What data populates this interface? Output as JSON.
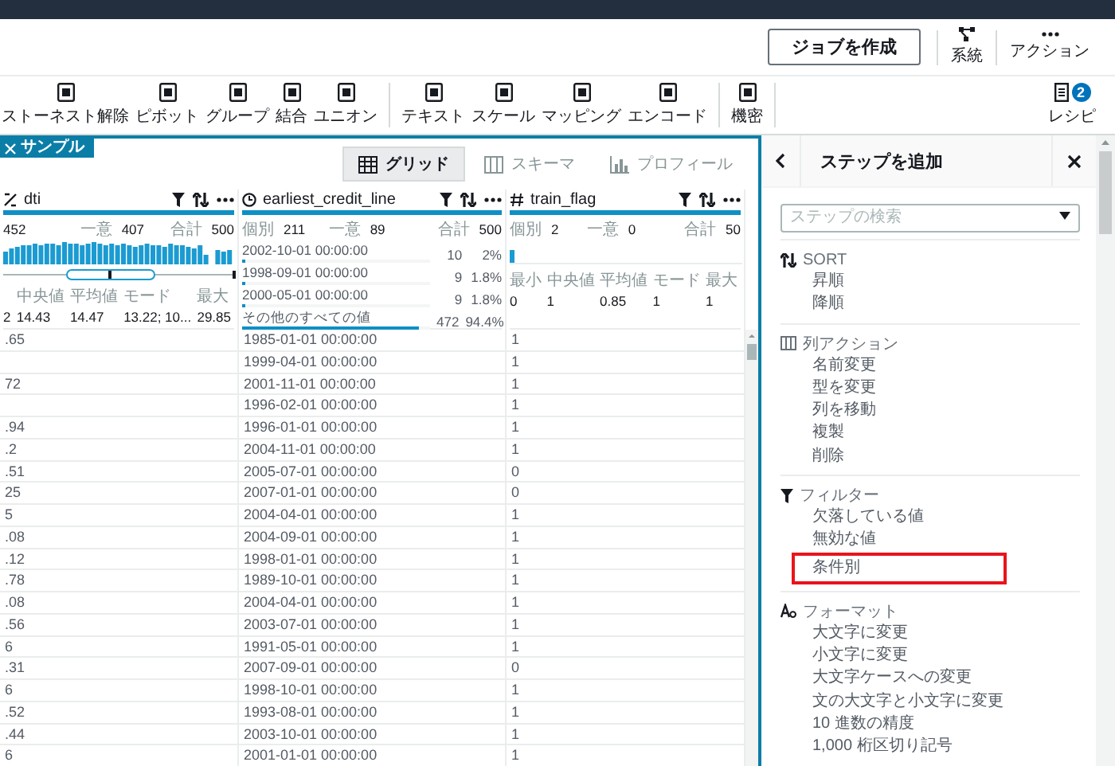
{
  "header": {
    "create_job_button": "ジョブを作成",
    "actions": [
      {
        "kind": "lineage",
        "label": "系統"
      },
      {
        "kind": "more",
        "label": "アクション"
      }
    ]
  },
  "toolbar": {
    "groups": [
      [
        {
          "label": "ストーネスト解除"
        },
        {
          "label": "ピボット"
        },
        {
          "label": "グループ"
        },
        {
          "label": "結合"
        },
        {
          "label": "ユニオン"
        }
      ],
      [
        {
          "label": "テキスト"
        },
        {
          "label": "スケール"
        },
        {
          "label": "マッピング"
        },
        {
          "label": "エンコード"
        }
      ],
      [
        {
          "label": "機密"
        }
      ]
    ],
    "recipe": {
      "label": "レシピ",
      "badge": "2"
    }
  },
  "dataset": {
    "sample_tag": "サンプル",
    "views": [
      {
        "kind": "grid",
        "label": "グリッド",
        "selected": true
      },
      {
        "kind": "schema",
        "label": "スキーマ",
        "selected": false
      },
      {
        "kind": "profile",
        "label": "プロフィール",
        "selected": false
      }
    ],
    "columns": [
      {
        "name": "dti",
        "kind": "decimal",
        "top_stats": [
          {
            "value": "452"
          },
          {
            "label": "一意",
            "value": "407"
          },
          {
            "label": "合計",
            "value": "500"
          }
        ],
        "stats": [
          {
            "value": "2"
          },
          {
            "label": "中央値",
            "value": "14.43"
          },
          {
            "label": "平均値",
            "value": "14.47"
          },
          {
            "label": "モード",
            "value": "13.22; 10..."
          },
          {
            "label": "最大",
            "value": "29.85"
          }
        ]
      },
      {
        "name": "earliest_credit_line",
        "kind": "datetime",
        "top_stats": [
          {
            "label": "個別",
            "value": "211"
          },
          {
            "label": "一意",
            "value": "89"
          },
          {
            "label": "合計",
            "value": "500"
          }
        ],
        "values": [
          {
            "label": "2002-10-01 00:00:00",
            "count": "10",
            "percent": "2%",
            "level": 0.02
          },
          {
            "label": "1998-09-01 00:00:00",
            "count": "9",
            "percent": "1.8%",
            "level": 0.018
          },
          {
            "label": "2000-05-01 00:00:00",
            "count": "9",
            "percent": "1.8%",
            "level": 0.018
          },
          {
            "label": "その他のすべての値",
            "count": "472",
            "percent": "94.4%",
            "level": 0.944
          }
        ]
      },
      {
        "name": "train_flag",
        "kind": "integer",
        "top_stats": [
          {
            "label": "個別",
            "value": "2"
          },
          {
            "label": "一意",
            "value": "0"
          },
          {
            "label": "合計",
            "value": "50"
          }
        ],
        "stats": [
          {
            "label": "最小",
            "value": "0"
          },
          {
            "label": "中央値",
            "value": "1"
          },
          {
            "label": "平均値",
            "value": "0.85"
          },
          {
            "label": "モード",
            "value": "1"
          },
          {
            "label": "最大",
            "value": "1"
          }
        ]
      }
    ],
    "rows": [
      [
        ".65",
        "1985-01-01 00:00:00",
        "1"
      ],
      [
        null,
        "1999-04-01 00:00:00",
        "1"
      ],
      [
        "72",
        "2001-11-01 00:00:00",
        "1"
      ],
      [
        null,
        "1996-02-01 00:00:00",
        "1"
      ],
      [
        ".94",
        "1996-01-01 00:00:00",
        "1"
      ],
      [
        ".2",
        "2004-11-01 00:00:00",
        "1"
      ],
      [
        ".51",
        "2005-07-01 00:00:00",
        "0"
      ],
      [
        "25",
        "2007-01-01 00:00:00",
        "0"
      ],
      [
        "5",
        "2004-04-01 00:00:00",
        "1"
      ],
      [
        ".08",
        "2004-09-01 00:00:00",
        "1"
      ],
      [
        ".12",
        "1998-01-01 00:00:00",
        "1"
      ],
      [
        ".78",
        "1989-10-01 00:00:00",
        "1"
      ],
      [
        ".08",
        "2004-04-01 00:00:00",
        "1"
      ],
      [
        ".56",
        "2003-07-01 00:00:00",
        "1"
      ],
      [
        "6",
        "1991-05-01 00:00:00",
        "1"
      ],
      [
        ".31",
        "2007-09-01 00:00:00",
        "0"
      ],
      [
        "6",
        "1998-10-01 00:00:00",
        "1"
      ],
      [
        ".52",
        "1993-08-01 00:00:00",
        "1"
      ],
      [
        ".44",
        "2003-10-01 00:00:00",
        "1"
      ],
      [
        "6",
        "2001-01-01 00:00:00",
        "1"
      ]
    ]
  },
  "step_panel": {
    "title": "ステップを追加",
    "search": {
      "placeholder": "ステップの検索"
    },
    "sections": [
      {
        "kind": "sort",
        "title": "SORT",
        "items": [
          {
            "label": "昇順",
            "highlighted": false
          },
          {
            "label": "降順",
            "highlighted": false
          }
        ]
      },
      {
        "kind": "columns",
        "title": "列アクション",
        "items": [
          {
            "label": "名前変更",
            "highlighted": false
          },
          {
            "label": "型を変更",
            "highlighted": false
          },
          {
            "label": "列を移動",
            "highlighted": false
          },
          {
            "label": "複製",
            "highlighted": false
          },
          {
            "label": "削除",
            "highlighted": false
          }
        ]
      },
      {
        "kind": "filter",
        "title": "フィルター",
        "items": [
          {
            "label": "欠落している値",
            "highlighted": false
          },
          {
            "label": "無効な値",
            "highlighted": false
          },
          {
            "label": "条件別",
            "highlighted": true
          }
        ]
      },
      {
        "kind": "format",
        "title": "フォーマット",
        "items": [
          {
            "label": "大文字に変更",
            "highlighted": false
          },
          {
            "label": "小文字に変更",
            "highlighted": false
          },
          {
            "label": "大文字ケースへの変更",
            "highlighted": false
          },
          {
            "label": "文の大文字と小文字に変更",
            "highlighted": false
          },
          {
            "label": "10 進数の精度",
            "highlighted": false
          },
          {
            "label": "1,000 桁区切り記号",
            "highlighted": false
          }
        ]
      }
    ]
  }
}
